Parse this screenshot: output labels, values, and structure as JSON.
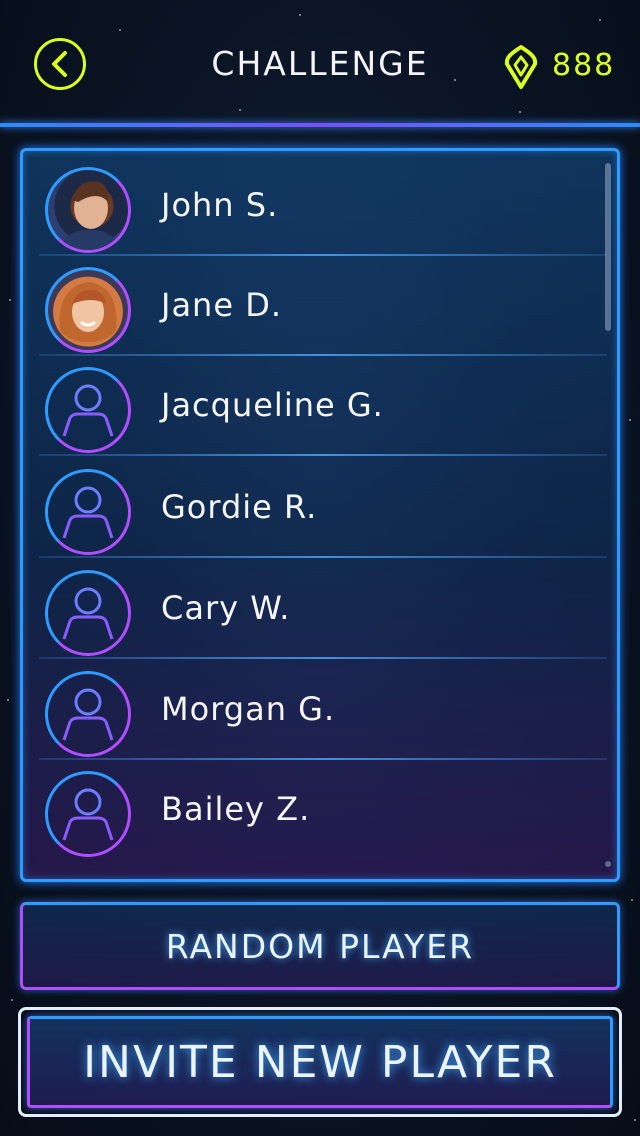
{
  "header": {
    "title": "CHALLENGE",
    "gem_count": "888",
    "back_icon": "chevron-left-icon",
    "currency_icon": "gem-icon"
  },
  "players": [
    {
      "name": "John S.",
      "avatar": "photo"
    },
    {
      "name": "Jane D.",
      "avatar": "photo"
    },
    {
      "name": "Jacqueline G.",
      "avatar": "placeholder"
    },
    {
      "name": "Gordie R.",
      "avatar": "placeholder"
    },
    {
      "name": "Cary W.",
      "avatar": "placeholder"
    },
    {
      "name": "Morgan G.",
      "avatar": "placeholder"
    },
    {
      "name": "Bailey Z.",
      "avatar": "placeholder"
    }
  ],
  "buttons": {
    "random": "RANDOM PLAYER",
    "invite": "INVITE NEW PLAYER"
  },
  "colors": {
    "accent_yellow": "#d8ff1e",
    "panel_border_blue": "#2f9bff",
    "panel_border_purple": "#b04dff"
  }
}
